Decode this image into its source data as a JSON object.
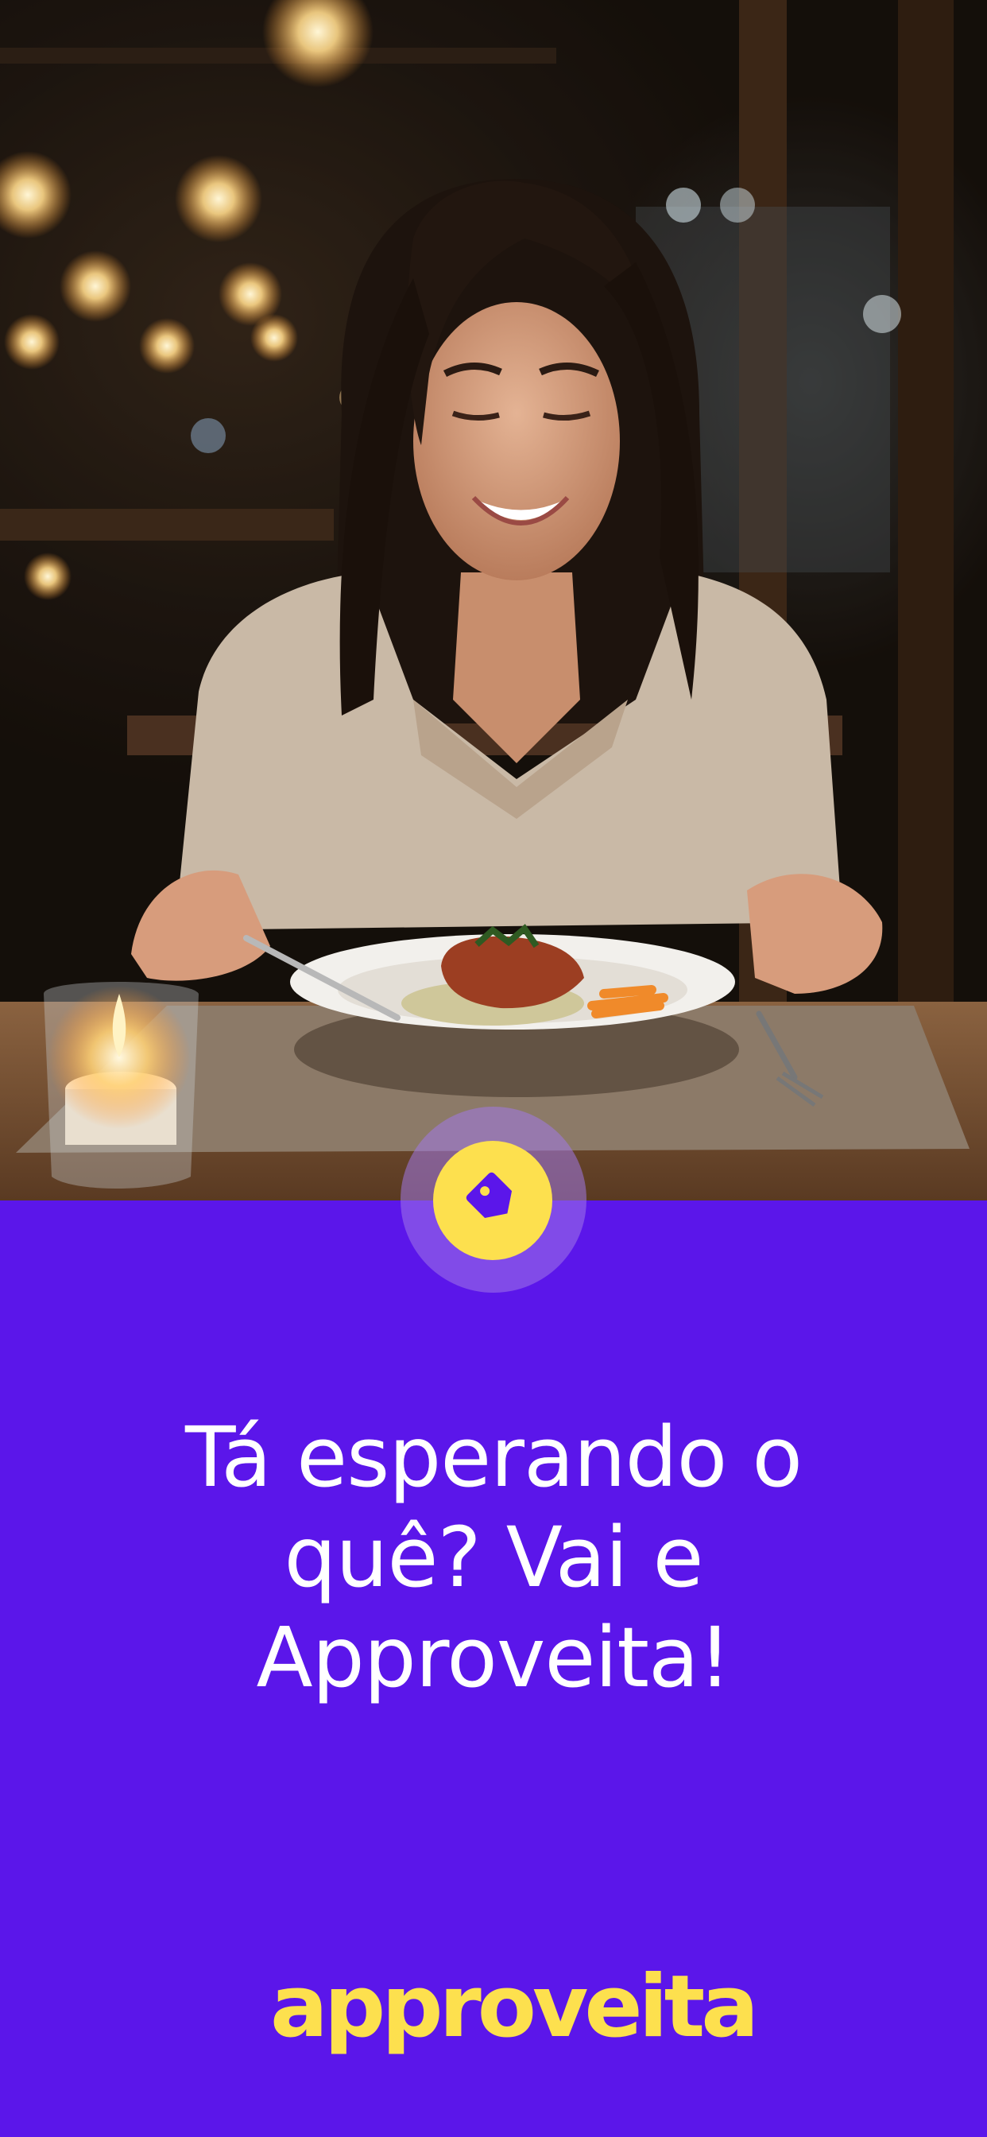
{
  "hero": {
    "image_description_icon": "photo-woman-dining",
    "colors": {
      "table": "#7a5636",
      "placemat": "#8c7a68",
      "sweater": "#c9b9a6"
    }
  },
  "badge": {
    "icon": "price-tag-icon",
    "icon_color": "#5b16ea",
    "fill": "#fde04e"
  },
  "headline": {
    "line1": "Tá esperando o",
    "line2": "quê? Vai e",
    "line3": "Approveita!"
  },
  "brand": {
    "logo_text": "approveita",
    "logo_color": "#fde04e",
    "background": "#5b16ea"
  }
}
